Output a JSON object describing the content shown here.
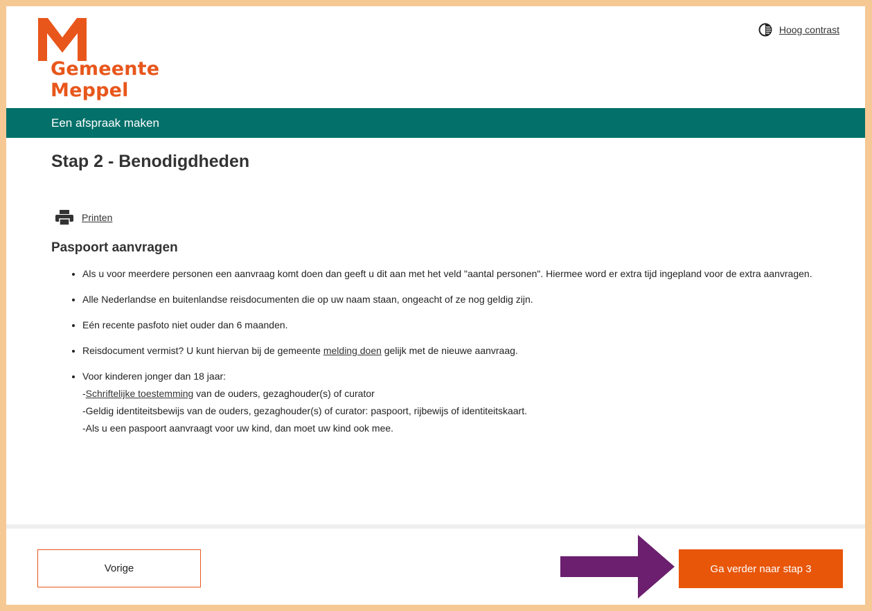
{
  "header": {
    "logo": {
      "line1": "Gemeente",
      "line2": "Meppel"
    },
    "contrast_link": "Hoog contrast"
  },
  "banner": {
    "title": "Een afspraak maken"
  },
  "step": {
    "title": "Stap 2 - Benodigdheden"
  },
  "print": {
    "label": "Printen"
  },
  "section": {
    "title": "Paspoort aanvragen",
    "bullet1": "Als u voor meerdere personen een aanvraag komt doen dan geeft u dit aan met het veld \"aantal personen\". Hiermee word er extra tijd ingepland voor de extra aanvragen.",
    "bullet2": "Alle Nederlandse en buitenlandse reisdocumenten die op uw naam staan, ongeacht of ze nog geldig zijn.",
    "bullet3": "Eén recente pasfoto niet ouder dan 6 maanden.",
    "bullet4": {
      "before": "Reisdocument vermist? U kunt hiervan bij de gemeente ",
      "link": "melding doen",
      "after": " gelijk met de nieuwe aanvraag."
    },
    "bullet5": {
      "intro": "Voor kinderen jonger dan 18 jaar:",
      "line1_prefix": "-",
      "line1_link": "Schriftelijke toestemming",
      "line1_rest": " van de ouders, gezaghouder(s) of curator",
      "line2": "-Geldig identiteitsbewijs van de ouders, gezaghouder(s) of curator: paspoort, rijbewijs of identiteitskaart.",
      "line3": "-Als u een paspoort aanvraagt voor uw kind, dan moet uw kind ook mee."
    }
  },
  "footer": {
    "prev_label": "Vorige",
    "next_label": "Ga verder naar stap 3"
  },
  "colors": {
    "brand_orange": "#e8561b",
    "banner_teal": "#04706a",
    "arrow_purple": "#6b1f6e",
    "page_border": "#f6c894"
  },
  "icons": [
    "m-logo-icon",
    "contrast-icon",
    "printer-icon",
    "purple-arrow-icon"
  ]
}
